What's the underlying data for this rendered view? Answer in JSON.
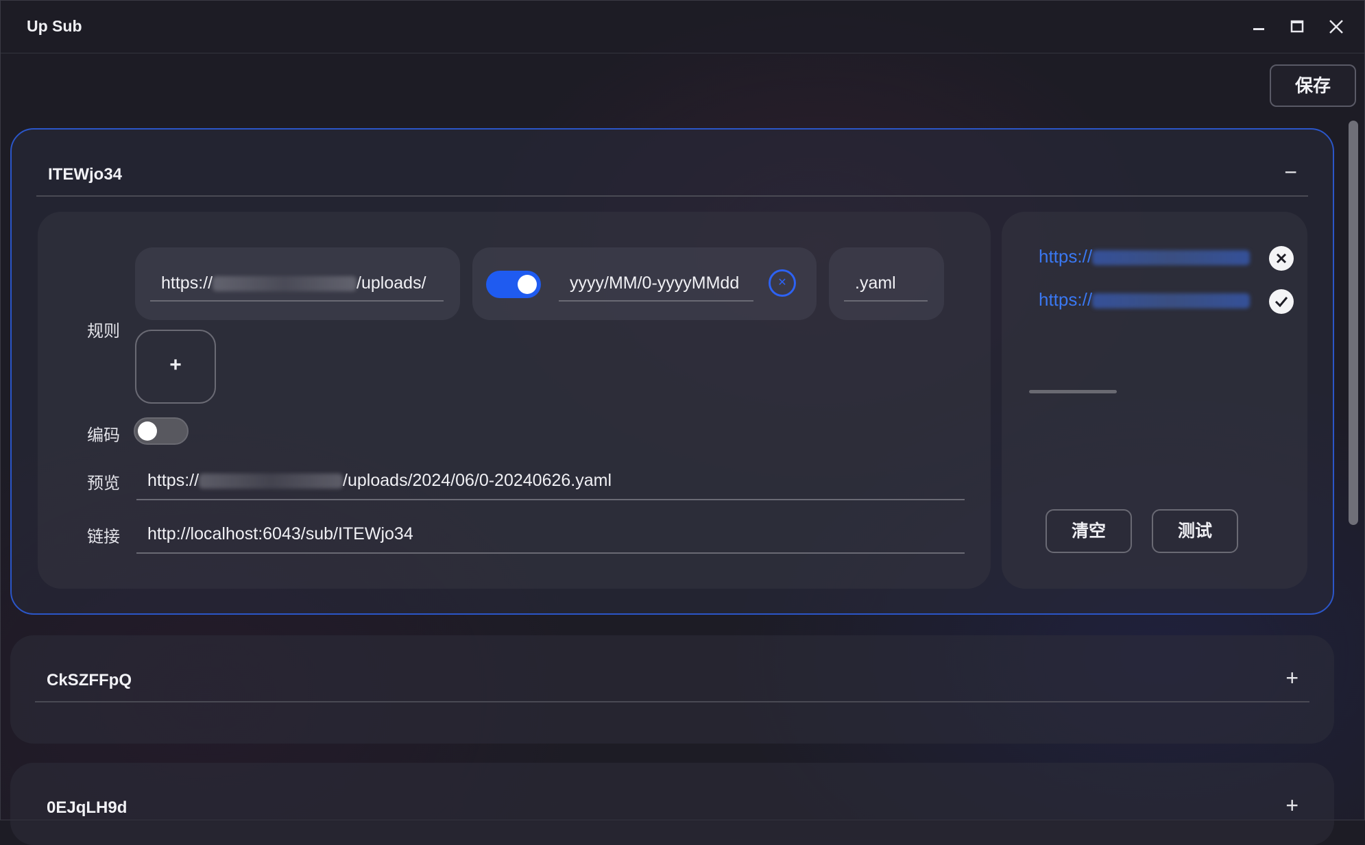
{
  "window": {
    "title": "Up Sub"
  },
  "toolbar": {
    "save_label": "保存"
  },
  "subscriptions": [
    {
      "name": "ITEWjo34",
      "expanded": true,
      "toggle_symbol": "−",
      "rules_label": "规则",
      "rule": {
        "url_prefix": "https://",
        "url_suffix": "/uploads/",
        "date_toggle_on": true,
        "date_format": "yyyy/MM/0-yyyyMMdd",
        "extension": ".yaml"
      },
      "add_rule_symbol": "+",
      "encode_label": "编码",
      "encode_on": false,
      "preview_label": "预览",
      "preview_prefix": "https://",
      "preview_suffix": "/uploads/2024/06/0-20240626.yaml",
      "link_label": "链接",
      "link_value": "http://localhost:6043/sub/ITEWjo34",
      "results": [
        {
          "url_prefix": "https://",
          "status": "fail"
        },
        {
          "url_prefix": "https://",
          "status": "success"
        }
      ],
      "clear_label": "清空",
      "test_label": "测试"
    },
    {
      "name": "CkSZFFpQ",
      "expanded": false,
      "toggle_symbol": "+"
    },
    {
      "name": "0EJqLH9d",
      "expanded": false,
      "toggle_symbol": "+"
    }
  ],
  "colors": {
    "accent": "#1f5bf0",
    "link": "#3a78f2",
    "card_border": "#2b56c9"
  }
}
